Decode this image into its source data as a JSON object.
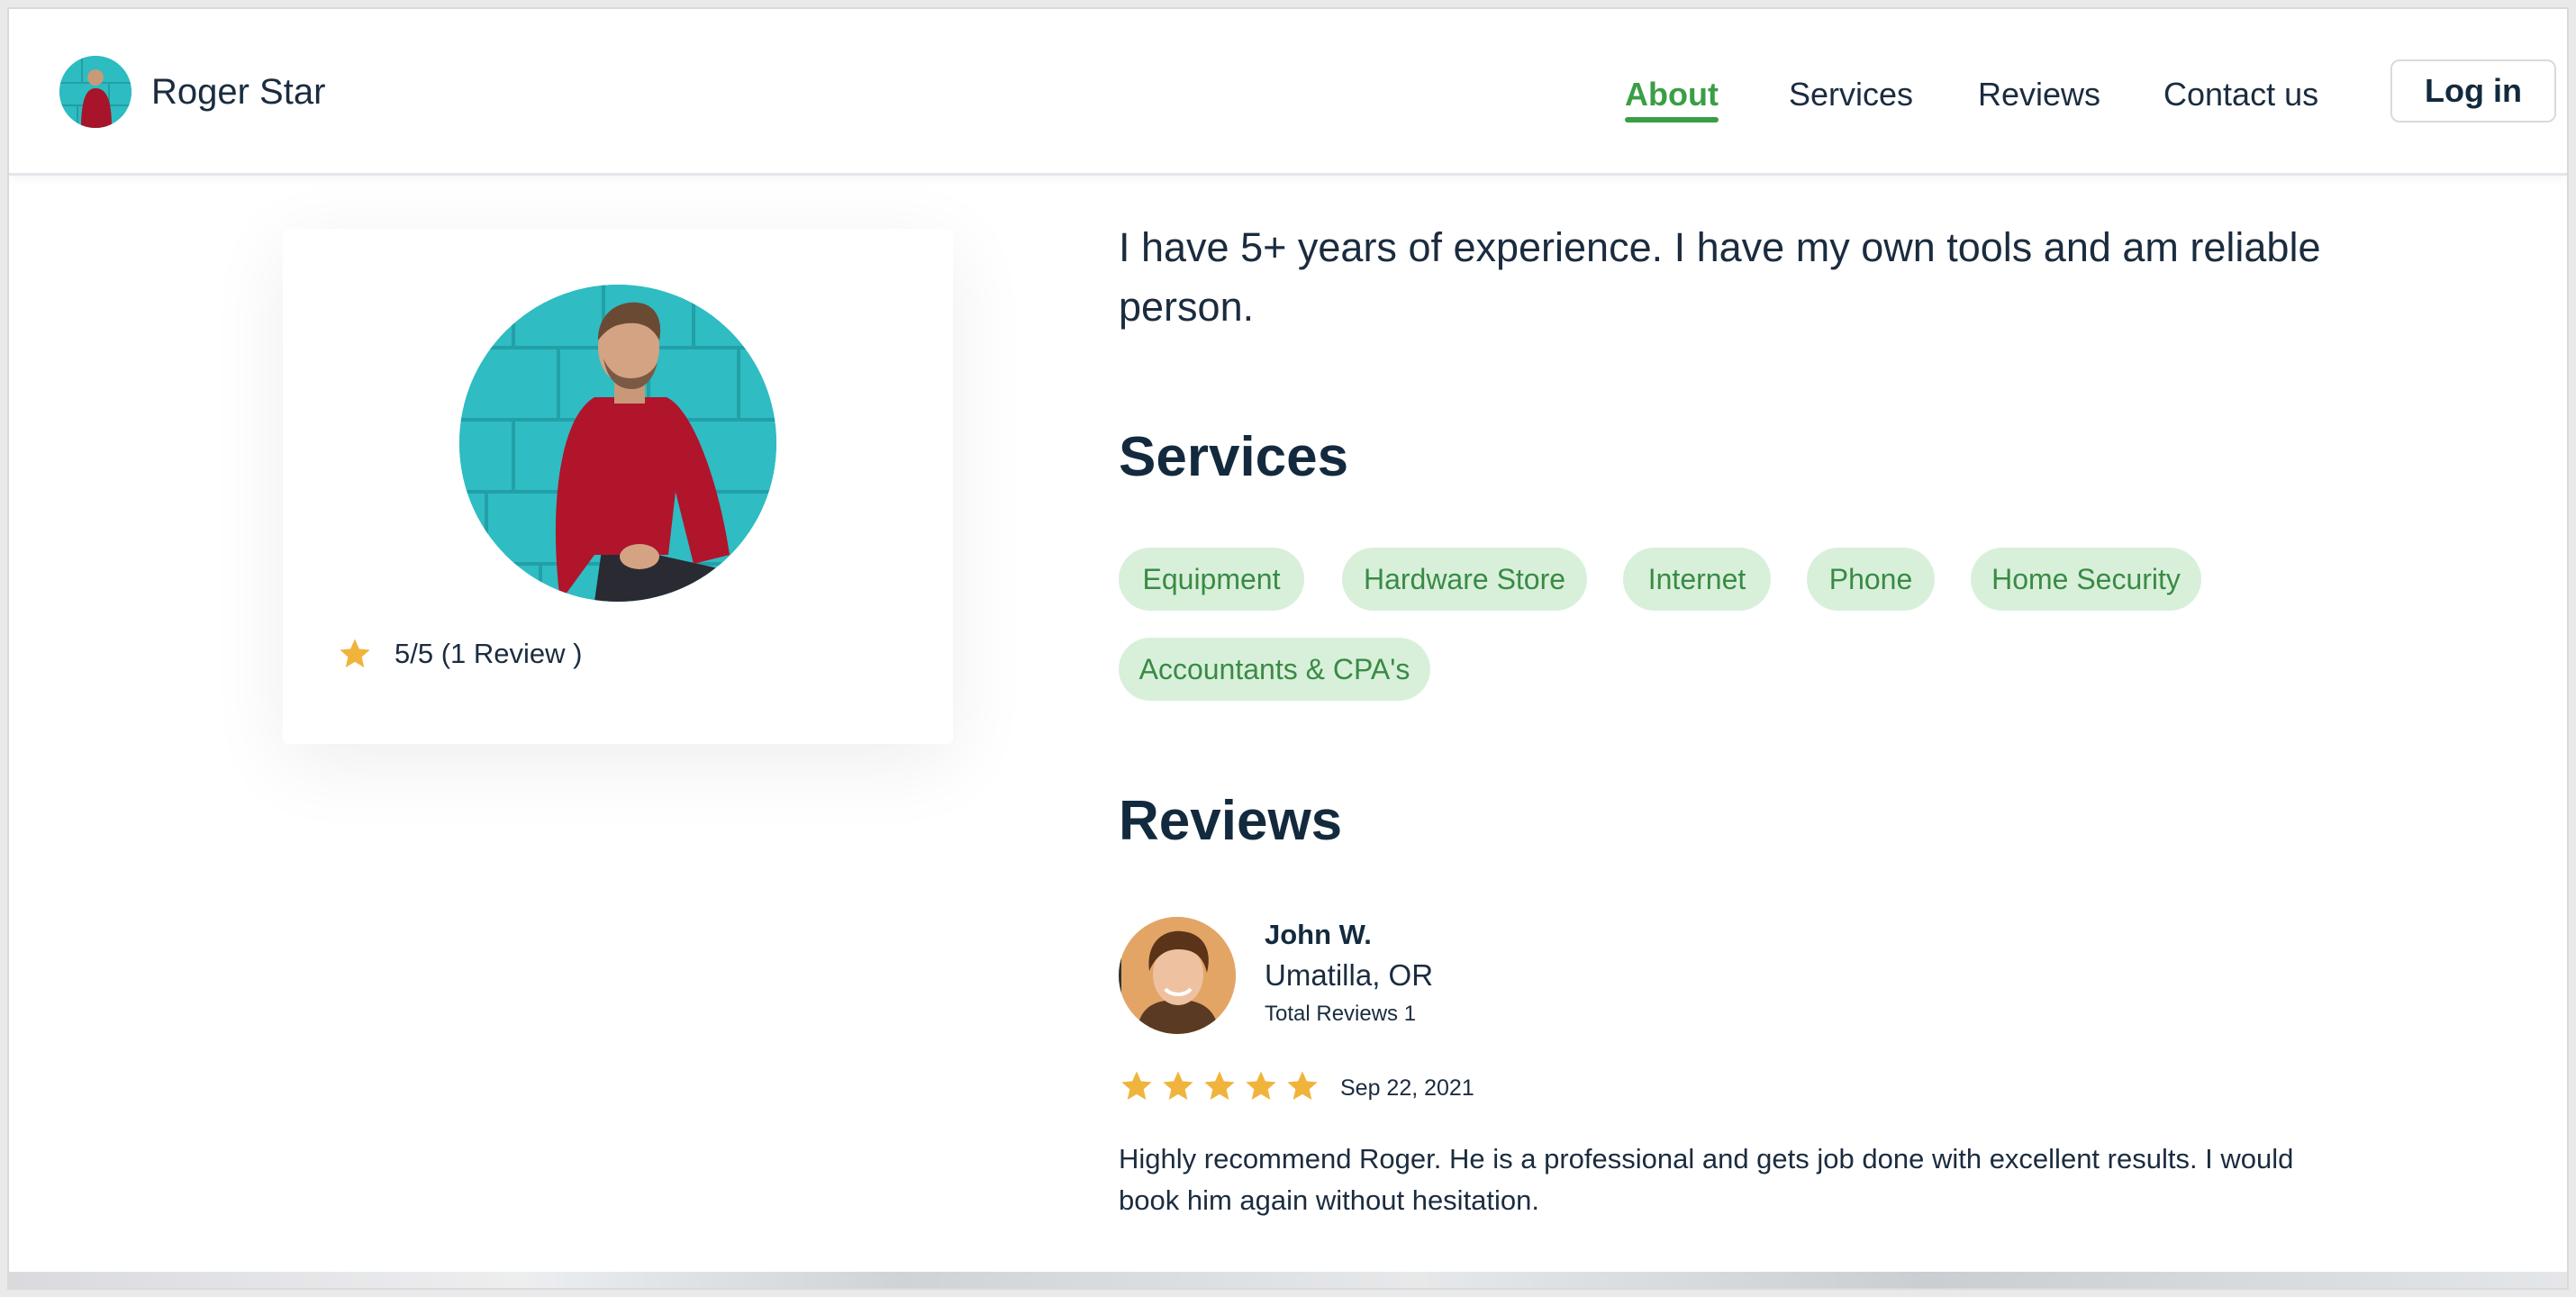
{
  "brand": {
    "name": "Roger Star"
  },
  "nav": {
    "items": [
      {
        "label": "About",
        "active": true
      },
      {
        "label": "Services",
        "active": false
      },
      {
        "label": "Reviews",
        "active": false
      },
      {
        "label": "Contact us",
        "active": false
      }
    ],
    "login_label": "Log in"
  },
  "profile": {
    "rating_text": "5/5 (1 Review )"
  },
  "about": {
    "intro": "I have 5+ years of experience. I have my own tools and am reliable person."
  },
  "services": {
    "title": "Services",
    "tags": [
      "Equipment",
      "Hardware Store",
      "Internet",
      "Phone",
      "Home Security",
      "Accountants & CPA's"
    ]
  },
  "reviews": {
    "title": "Reviews",
    "items": [
      {
        "name": "John W.",
        "location": "Umatilla, OR",
        "total_reviews": "Total Reviews 1",
        "stars": 5,
        "date": "Sep 22, 2021",
        "text": "Highly recommend Roger. He is a professional and gets job done with excellent results. I would book him again without hesitation."
      }
    ]
  },
  "colors": {
    "accent": "#3a9e45",
    "tag_bg": "#d8f0da",
    "star": "#f0b43c",
    "text_dark": "#132a3e"
  }
}
